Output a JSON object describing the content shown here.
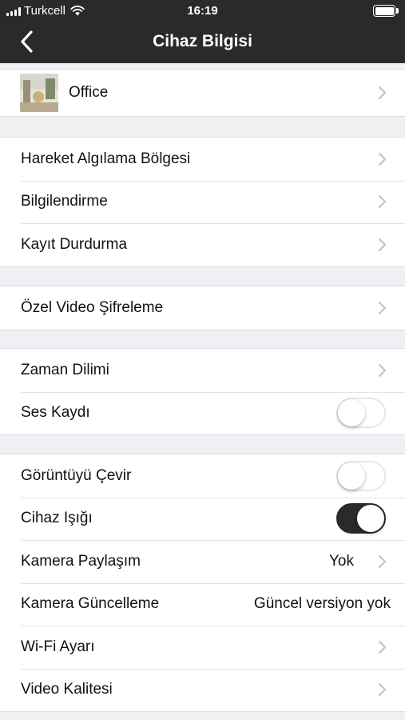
{
  "status_bar": {
    "carrier": "Turkcell",
    "time": "16:19"
  },
  "nav": {
    "title": "Cihaz Bilgisi"
  },
  "device": {
    "name": "Office"
  },
  "groups": {
    "detection": {
      "motion_zone": "Hareket Algılama Bölgesi",
      "notification": "Bilgilendirme",
      "recording_stop": "Kayıt Durdurma"
    },
    "encryption": {
      "label": "Özel Video Şifreleme"
    },
    "time_audio": {
      "timezone": "Zaman Dilimi",
      "audio_recording": "Ses Kaydı",
      "audio_recording_on": false
    },
    "camera": {
      "flip_image": "Görüntüyü Çevir",
      "flip_image_on": false,
      "device_light": "Cihaz Işığı",
      "device_light_on": true,
      "camera_share": "Kamera Paylaşım",
      "camera_share_value": "Yok",
      "camera_update": "Kamera Güncelleme",
      "camera_update_value": "Güncel versiyon yok",
      "wifi_settings": "Wi-Fi Ayarı",
      "video_quality": "Video Kalitesi"
    }
  },
  "colors": {
    "header_bg": "#2a2a2a",
    "page_bg": "#efeff4",
    "toggle_on": "#2a2a2a",
    "chevron": "#c4c4c8"
  }
}
